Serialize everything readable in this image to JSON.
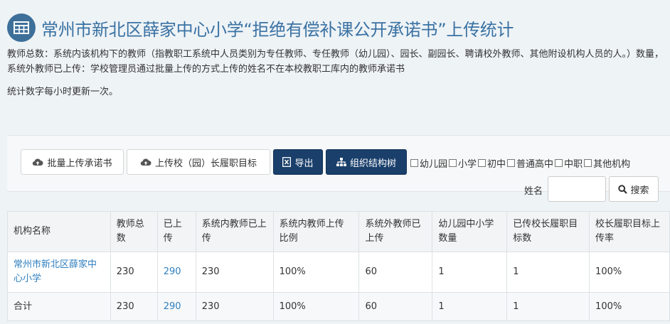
{
  "title": "常州市新北区薛家中心小学“拒绝有偿补课公开承诺书”上传统计",
  "description": "教师总数：系统内该机构下的教师（指教职工系统中人员类别为专任教师、专任教师（幼儿园）、园长、副园长、聘请校外教师、其他附设机构人员的人。）数量，系统外教师已上传：学校管理员通过批量上传的方式上传的姓名不在本校教职工库内的教师承诺书",
  "update_note": "统计数字每小时更新一次。",
  "toolbar": {
    "batch_upload": "批量上传承诺书",
    "upload_principal": "上传校（园）长履职目标",
    "export": "导出",
    "org_tree": "组织结构树"
  },
  "filters": [
    "幼儿园",
    "小学",
    "初中",
    "普通高中",
    "中职",
    "其他机构"
  ],
  "search": {
    "label": "姓名",
    "placeholder": "",
    "button": "搜索"
  },
  "table": {
    "headers": [
      "机构名称",
      "教师总数",
      "已上传",
      "系统内教师已上传",
      "系统内教师上传比例",
      "系统外教师已上传",
      "幼儿园中小学数量",
      "已传校长履职目标数",
      "校长履职目标上传率"
    ],
    "rows": [
      [
        "常州市新北区薛家中心小学",
        "230",
        "290",
        "230",
        "100%",
        "60",
        "1",
        "1",
        "100%"
      ]
    ],
    "total": [
      "合计",
      "230",
      "290",
      "230",
      "100%",
      "60",
      "1",
      "1",
      "100%"
    ]
  },
  "colors": {
    "accent": "#3a72a3",
    "primary_button": "#1a3f6b",
    "link": "#2f7fbf"
  },
  "icons": {
    "title": "table-icon",
    "upload": "cloud-upload-icon",
    "export": "excel-icon",
    "tree": "sitemap-icon",
    "search": "search-icon"
  }
}
